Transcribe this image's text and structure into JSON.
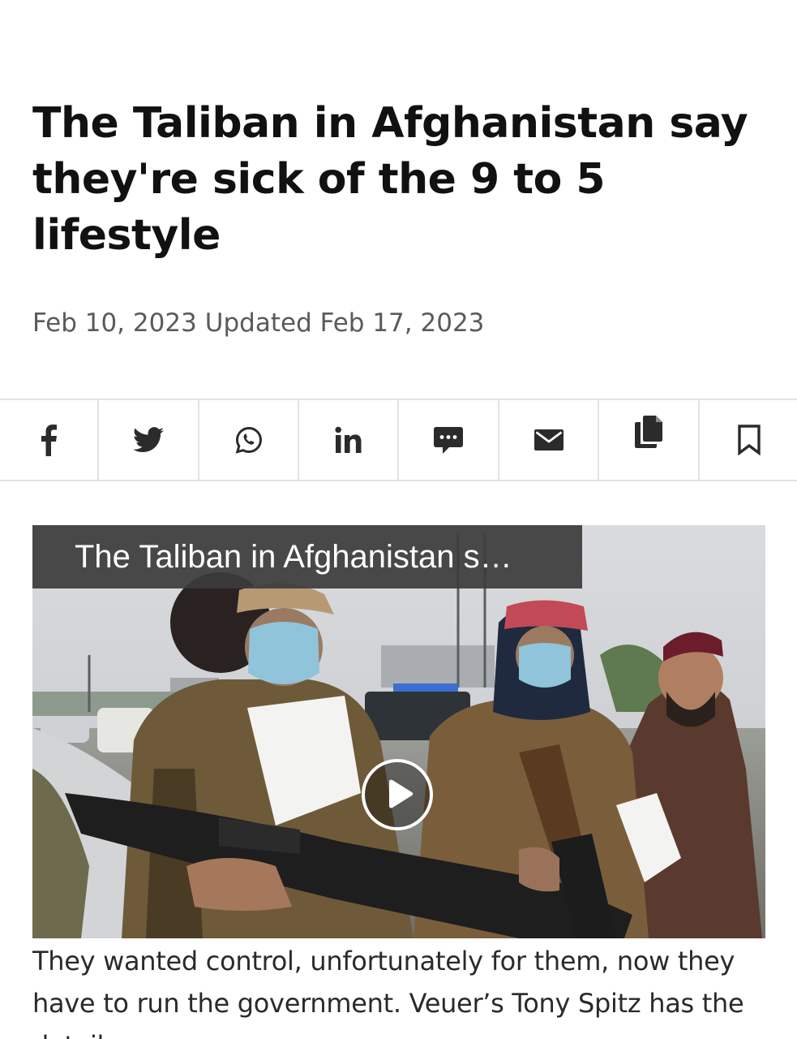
{
  "article": {
    "headline": "The Taliban in Afghanistan say they're sick of the 9 to 5 lifestyle",
    "published": "Feb 10, 2023",
    "updated": "Updated Feb 17, 2023",
    "summary": "They wanted control, unfortunately for them, now they have to run the government. Veuer’s Tony Spitz has the details."
  },
  "share_bar": {
    "buttons": [
      {
        "name": "facebook",
        "icon": "facebook-icon",
        "label": "f"
      },
      {
        "name": "twitter",
        "icon": "twitter-icon"
      },
      {
        "name": "whatsapp",
        "icon": "whatsapp-icon"
      },
      {
        "name": "linkedin",
        "icon": "linkedin-icon",
        "label": "in"
      },
      {
        "name": "comments",
        "icon": "comment-icon"
      },
      {
        "name": "email",
        "icon": "envelope-icon"
      },
      {
        "name": "copy-link",
        "icon": "copy-icon"
      },
      {
        "name": "bookmark",
        "icon": "bookmark-icon"
      }
    ],
    "icon_color": "#2b2b2b"
  },
  "video": {
    "title": "The Taliban in Afghanistan s…",
    "play_icon": "play-icon"
  },
  "colors": {
    "headline": "#111111",
    "dates": "#5a5a5a",
    "divider": "#e3e3e3",
    "video_title_bg": "#3c3c3c"
  }
}
